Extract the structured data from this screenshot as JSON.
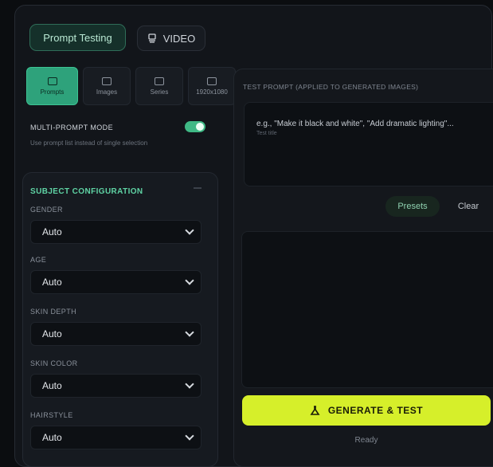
{
  "tabs": {
    "prompt_testing": "Prompt Testing",
    "video": "VIDEO"
  },
  "modes": [
    {
      "label": "Prompts",
      "icon": "grid-icon",
      "selected": true
    },
    {
      "label": "Images",
      "icon": "images-icon",
      "selected": false
    },
    {
      "label": "Series",
      "icon": "series-icon",
      "selected": false
    },
    {
      "label": "1920x1080",
      "icon": "resolution-icon",
      "selected": false
    }
  ],
  "multi_prompt": {
    "label": "MULTI-PROMPT MODE",
    "description": "Use prompt list instead of single selection",
    "enabled": true
  },
  "subject": {
    "title": "SUBJECT CONFIGURATION",
    "fields": [
      {
        "label": "GENDER",
        "value": "Auto"
      },
      {
        "label": "AGE",
        "value": "Auto"
      },
      {
        "label": "SKIN DEPTH",
        "value": "Auto"
      },
      {
        "label": "SKIN COLOR",
        "value": "Auto"
      },
      {
        "label": "HAIRSTYLE",
        "value": "Auto"
      }
    ]
  },
  "test_prompt": {
    "label": "TEST PROMPT (APPLIED TO GENERATED IMAGES)",
    "placeholder": "e.g., \"Make it black and white\", \"Add dramatic lighting\"...",
    "hint": "Test title",
    "presets_label": "Presets",
    "clear_label": "Clear"
  },
  "generate": {
    "label": "GENERATE & TEST",
    "status": "Ready"
  },
  "colors": {
    "accent_green": "#2ea27b",
    "generate_lime": "#d6ef2a",
    "background": "#0b0d10"
  }
}
